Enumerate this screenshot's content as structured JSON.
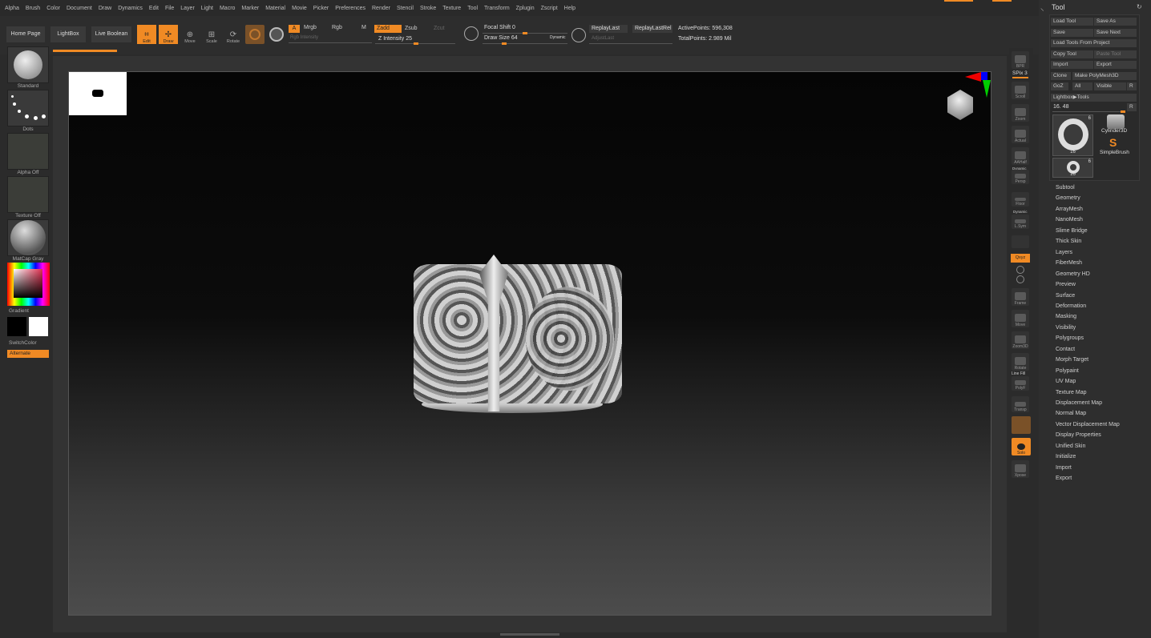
{
  "menu": [
    "Alpha",
    "Brush",
    "Color",
    "Document",
    "Draw",
    "Dynamics",
    "Edit",
    "File",
    "Layer",
    "Light",
    "Macro",
    "Marker",
    "Material",
    "Movie",
    "Picker",
    "Preferences",
    "Render",
    "Stencil",
    "Stroke",
    "Texture",
    "Tool",
    "Transform",
    "Zplugin",
    "Zscript",
    "Help"
  ],
  "top_shelf": {
    "home_page": "Home Page",
    "lightbox": "LightBox",
    "live_boolean": "Live Boolean",
    "edit": "Edit",
    "draw": "Draw",
    "move": "Move",
    "scale": "Scale",
    "rotate": "Rotate",
    "a_btn": "A",
    "mrgb": "Mrgb",
    "rgb": "Rgb",
    "m": "M",
    "rgb_intensity": "Rgb Intensity",
    "zadd": "Zadd",
    "zsub": "Zsub",
    "zcut": "Zcut",
    "z_intensity": "Z Intensity 25",
    "focal_shift": "Focal Shift 0",
    "draw_size": "Draw Size 64",
    "dynamic": "Dynamic",
    "replay_last": "ReplayLast",
    "replay_last_rel": "ReplayLastRel",
    "adjust_last": "AdjustLast",
    "active_points": "ActivePoints: 596,308",
    "total_points": "TotalPoints: 2.989 Mil"
  },
  "left_shelf": {
    "standard": "Standard",
    "dots": "Dots",
    "alpha_off": "Alpha Off",
    "texture_off": "Texture Off",
    "matcap": "MatCap Gray",
    "gradient": "Gradient",
    "switch_color": "SwitchColor",
    "alternate": "Alternate"
  },
  "right_shelf": {
    "bpr": "BPR",
    "spix": "SPix 3",
    "scroll": "Scroll",
    "zoom": "Zoom",
    "actual": "Actual",
    "aahalf": "AAHalf",
    "dynamic": "Dynamic",
    "persp": "Persp",
    "floor": "Floor",
    "dynamic2": "Dynamic",
    "lsym": "L.Sym",
    "xyz": "Qxyz",
    "frame": "Frame",
    "move": "Move",
    "zoom3d": "Zoom3D",
    "rotate": "Rotate",
    "line_fill": "Line Fill",
    "polyf": "PolyF",
    "transp": "Transp",
    "solo": "Solo",
    "xpose": "Xpose"
  },
  "tool_panel": {
    "title": "Tool",
    "load_tool": "Load Tool",
    "save_as": "Save As",
    "save": "Save",
    "save_next": "Save Next",
    "load_from_project": "Load Tools From Project",
    "copy_tool": "Copy Tool",
    "paste_tool": "Paste Tool",
    "import": "Import",
    "export": "Export",
    "clone": "Clone",
    "make_polymesh": "Make PolyMesh3D",
    "goz": "GoZ",
    "all": "All",
    "visible": "Visible",
    "r": "R",
    "lightbox_tools": "Lightbox▶Tools",
    "tool_count": "16. 48",
    "r2": "R",
    "thumb_count_a": "6",
    "thumb_count_b": "16",
    "cylinder": "Cylinder3D",
    "simplebrush": "SimpleBrush",
    "thumb_count_c": "6",
    "thumb_count_d": "16",
    "subpalettes": [
      "Subtool",
      "Geometry",
      "ArrayMesh",
      "NanoMesh",
      "Slime Bridge",
      "Thick Skin",
      "Layers",
      "FiberMesh",
      "Geometry HD",
      "Preview",
      "Surface",
      "Deformation",
      "Masking",
      "Visibility",
      "Polygroups",
      "Contact",
      "Morph Target",
      "Polypaint",
      "UV Map",
      "Texture Map",
      "Displacement Map",
      "Normal Map",
      "Vector Displacement Map",
      "Display Properties",
      "Unified Skin",
      "Initialize",
      "Import",
      "Export"
    ]
  },
  "colors": {
    "accent": "#f08a24",
    "bg": "#2b2b2b",
    "canvas": "#0a0a0a"
  }
}
